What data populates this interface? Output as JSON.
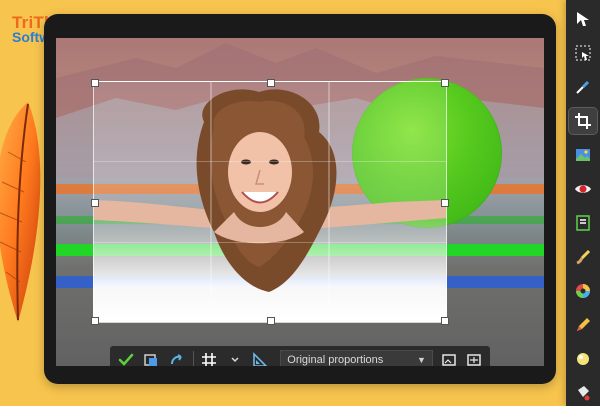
{
  "brand": {
    "line1": "TriThuc",
    "line2": "Software",
    "colors": {
      "line1": "#ef6a1f",
      "line2": "#2a7fd4"
    }
  },
  "crop_toolbar": {
    "aspect_option": "Original proportions",
    "icons": [
      "checkmark-icon",
      "crop-to-new-image-icon",
      "rotate-icon",
      "grid-icon",
      "grid-dropdown-icon",
      "ruler-triangle-icon",
      "landscape-orientation-icon",
      "fit-to-canvas-icon"
    ]
  },
  "right_tools": {
    "icons": [
      "arrow-pointer-icon",
      "selection-tool-icon",
      "eyedropper-icon",
      "crop-icon",
      "image-adjust-icon",
      "red-eye-icon",
      "level-icon",
      "paintbrush-icon",
      "color-wheel-icon",
      "pencil-icon",
      "dodge-icon",
      "paint-bucket-icon"
    ],
    "active_index": 3,
    "accent": "#f7c44d"
  }
}
